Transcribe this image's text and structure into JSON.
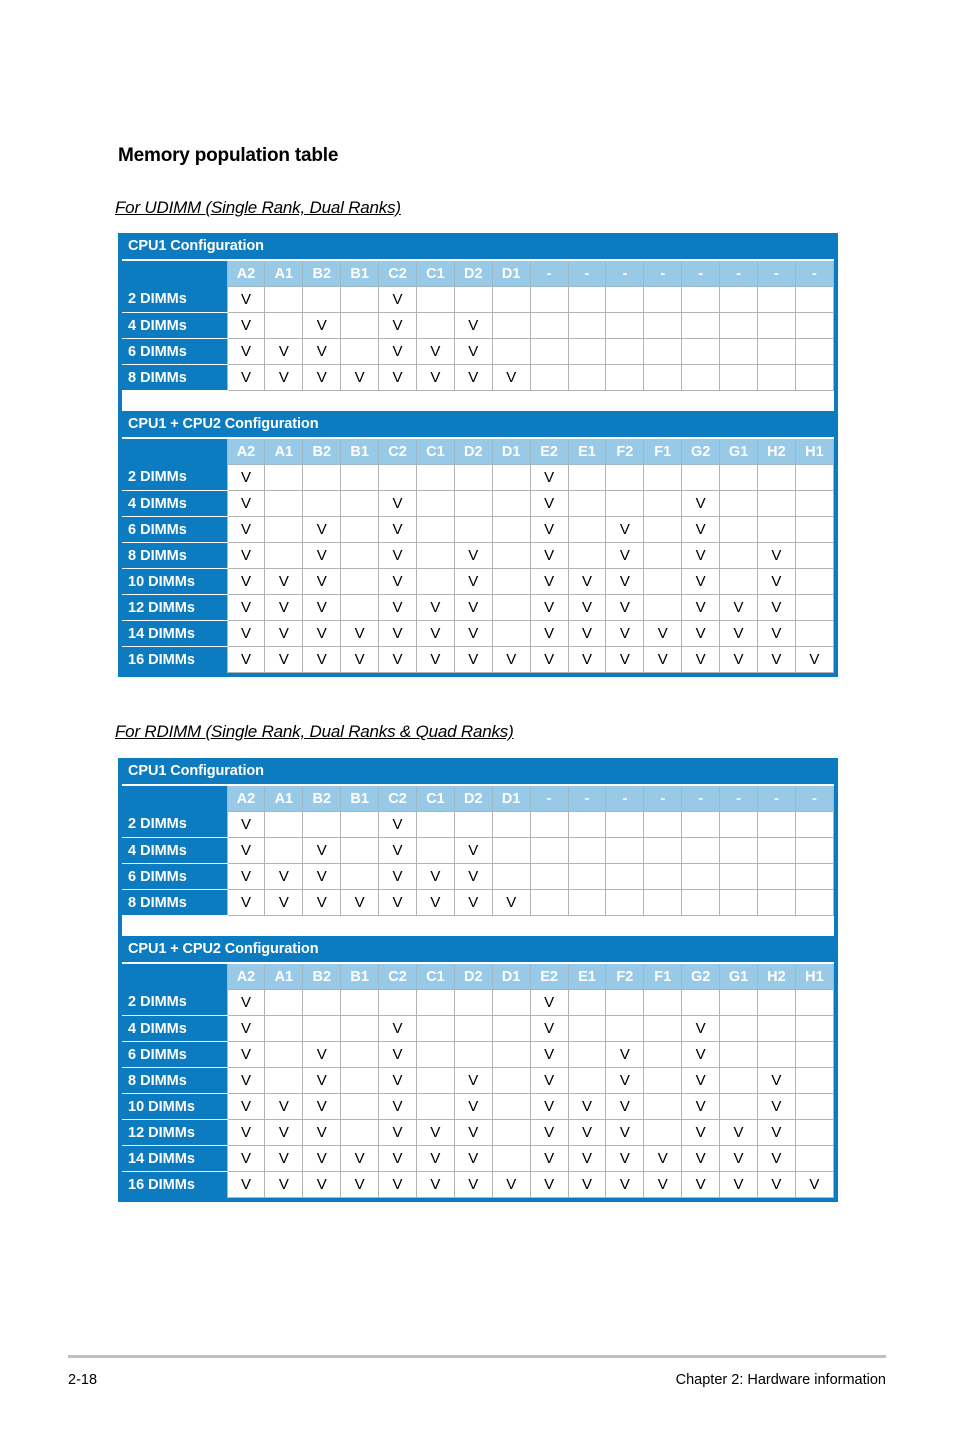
{
  "document": {
    "title": "Memory population table",
    "sections": [
      {
        "id": "udimm",
        "heading": "For UDIMM (Single Rank, Dual Ranks)",
        "tables": [
          {
            "title": "CPU1 Configuration",
            "columns": [
              "A2",
              "A1",
              "B2",
              "B1",
              "C2",
              "C1",
              "D2",
              "D1",
              "-",
              "-",
              "-",
              "-",
              "-",
              "-",
              "-",
              "-"
            ],
            "rows": [
              {
                "label": "2 DIMMs",
                "cells": [
                  "V",
                  "",
                  "",
                  "",
                  "V",
                  "",
                  "",
                  "",
                  "",
                  "",
                  "",
                  "",
                  "",
                  "",
                  "",
                  ""
                ]
              },
              {
                "label": "4 DIMMs",
                "cells": [
                  "V",
                  "",
                  "V",
                  "",
                  "V",
                  "",
                  "V",
                  "",
                  "",
                  "",
                  "",
                  "",
                  "",
                  "",
                  "",
                  ""
                ]
              },
              {
                "label": "6 DIMMs",
                "cells": [
                  "V",
                  "V",
                  "V",
                  "",
                  "V",
                  "V",
                  "V",
                  "",
                  "",
                  "",
                  "",
                  "",
                  "",
                  "",
                  "",
                  ""
                ]
              },
              {
                "label": "8 DIMMs",
                "cells": [
                  "V",
                  "V",
                  "V",
                  "V",
                  "V",
                  "V",
                  "V",
                  "V",
                  "",
                  "",
                  "",
                  "",
                  "",
                  "",
                  "",
                  ""
                ]
              }
            ]
          },
          {
            "title": "CPU1 + CPU2 Configuration",
            "columns": [
              "A2",
              "A1",
              "B2",
              "B1",
              "C2",
              "C1",
              "D2",
              "D1",
              "E2",
              "E1",
              "F2",
              "F1",
              "G2",
              "G1",
              "H2",
              "H1"
            ],
            "rows": [
              {
                "label": "2 DIMMs",
                "cells": [
                  "V",
                  "",
                  "",
                  "",
                  "",
                  "",
                  "",
                  "",
                  "V",
                  "",
                  "",
                  "",
                  "",
                  "",
                  "",
                  ""
                ]
              },
              {
                "label": "4 DIMMs",
                "cells": [
                  "V",
                  "",
                  "",
                  "",
                  "V",
                  "",
                  "",
                  "",
                  "V",
                  "",
                  "",
                  "",
                  "V",
                  "",
                  "",
                  ""
                ]
              },
              {
                "label": "6 DIMMs",
                "cells": [
                  "V",
                  "",
                  "V",
                  "",
                  "V",
                  "",
                  "",
                  "",
                  "V",
                  "",
                  "V",
                  "",
                  "V",
                  "",
                  "",
                  ""
                ]
              },
              {
                "label": "8 DIMMs",
                "cells": [
                  "V",
                  "",
                  "V",
                  "",
                  "V",
                  "",
                  "V",
                  "",
                  "V",
                  "",
                  "V",
                  "",
                  "V",
                  "",
                  "V",
                  ""
                ]
              },
              {
                "label": "10 DIMMs",
                "cells": [
                  "V",
                  "V",
                  "V",
                  "",
                  "V",
                  "",
                  "V",
                  "",
                  "V",
                  "V",
                  "V",
                  "",
                  "V",
                  "",
                  "V",
                  ""
                ]
              },
              {
                "label": "12 DIMMs",
                "cells": [
                  "V",
                  "V",
                  "V",
                  "",
                  "V",
                  "V",
                  "V",
                  "",
                  "V",
                  "V",
                  "V",
                  "",
                  "V",
                  "V",
                  "V",
                  ""
                ]
              },
              {
                "label": "14 DIMMs",
                "cells": [
                  "V",
                  "V",
                  "V",
                  "V",
                  "V",
                  "V",
                  "V",
                  "",
                  "V",
                  "V",
                  "V",
                  "V",
                  "V",
                  "V",
                  "V",
                  ""
                ]
              },
              {
                "label": "16 DIMMs",
                "cells": [
                  "V",
                  "V",
                  "V",
                  "V",
                  "V",
                  "V",
                  "V",
                  "V",
                  "V",
                  "V",
                  "V",
                  "V",
                  "V",
                  "V",
                  "V",
                  "V"
                ]
              }
            ]
          }
        ]
      },
      {
        "id": "rdimm",
        "heading": "For RDIMM (Single Rank, Dual Ranks & Quad Ranks)",
        "tables": [
          {
            "title": "CPU1 Configuration",
            "columns": [
              "A2",
              "A1",
              "B2",
              "B1",
              "C2",
              "C1",
              "D2",
              "D1",
              "-",
              "-",
              "-",
              "-",
              "-",
              "-",
              "-",
              "-"
            ],
            "rows": [
              {
                "label": "2 DIMMs",
                "cells": [
                  "V",
                  "",
                  "",
                  "",
                  "V",
                  "",
                  "",
                  "",
                  "",
                  "",
                  "",
                  "",
                  "",
                  "",
                  "",
                  ""
                ]
              },
              {
                "label": "4 DIMMs",
                "cells": [
                  "V",
                  "",
                  "V",
                  "",
                  "V",
                  "",
                  "V",
                  "",
                  "",
                  "",
                  "",
                  "",
                  "",
                  "",
                  "",
                  ""
                ]
              },
              {
                "label": "6 DIMMs",
                "cells": [
                  "V",
                  "V",
                  "V",
                  "",
                  "V",
                  "V",
                  "V",
                  "",
                  "",
                  "",
                  "",
                  "",
                  "",
                  "",
                  "",
                  ""
                ]
              },
              {
                "label": "8 DIMMs",
                "cells": [
                  "V",
                  "V",
                  "V",
                  "V",
                  "V",
                  "V",
                  "V",
                  "V",
                  "",
                  "",
                  "",
                  "",
                  "",
                  "",
                  "",
                  ""
                ]
              }
            ]
          },
          {
            "title": "CPU1 + CPU2 Configuration",
            "columns": [
              "A2",
              "A1",
              "B2",
              "B1",
              "C2",
              "C1",
              "D2",
              "D1",
              "E2",
              "E1",
              "F2",
              "F1",
              "G2",
              "G1",
              "H2",
              "H1"
            ],
            "rows": [
              {
                "label": "2 DIMMs",
                "cells": [
                  "V",
                  "",
                  "",
                  "",
                  "",
                  "",
                  "",
                  "",
                  "V",
                  "",
                  "",
                  "",
                  "",
                  "",
                  "",
                  ""
                ]
              },
              {
                "label": "4 DIMMs",
                "cells": [
                  "V",
                  "",
                  "",
                  "",
                  "V",
                  "",
                  "",
                  "",
                  "V",
                  "",
                  "",
                  "",
                  "V",
                  "",
                  "",
                  ""
                ]
              },
              {
                "label": "6 DIMMs",
                "cells": [
                  "V",
                  "",
                  "V",
                  "",
                  "V",
                  "",
                  "",
                  "",
                  "V",
                  "",
                  "V",
                  "",
                  "V",
                  "",
                  "",
                  ""
                ]
              },
              {
                "label": "8 DIMMs",
                "cells": [
                  "V",
                  "",
                  "V",
                  "",
                  "V",
                  "",
                  "V",
                  "",
                  "V",
                  "",
                  "V",
                  "",
                  "V",
                  "",
                  "V",
                  ""
                ]
              },
              {
                "label": "10 DIMMs",
                "cells": [
                  "V",
                  "V",
                  "V",
                  "",
                  "V",
                  "",
                  "V",
                  "",
                  "V",
                  "V",
                  "V",
                  "",
                  "V",
                  "",
                  "V",
                  ""
                ]
              },
              {
                "label": "12 DIMMs",
                "cells": [
                  "V",
                  "V",
                  "V",
                  "",
                  "V",
                  "V",
                  "V",
                  "",
                  "V",
                  "V",
                  "V",
                  "",
                  "V",
                  "V",
                  "V",
                  ""
                ]
              },
              {
                "label": "14 DIMMs",
                "cells": [
                  "V",
                  "V",
                  "V",
                  "V",
                  "V",
                  "V",
                  "V",
                  "",
                  "V",
                  "V",
                  "V",
                  "V",
                  "V",
                  "V",
                  "V",
                  ""
                ]
              },
              {
                "label": "16 DIMMs",
                "cells": [
                  "V",
                  "V",
                  "V",
                  "V",
                  "V",
                  "V",
                  "V",
                  "V",
                  "V",
                  "V",
                  "V",
                  "V",
                  "V",
                  "V",
                  "V",
                  "V"
                ]
              }
            ]
          }
        ]
      }
    ]
  },
  "footer": {
    "page_number": "2-18",
    "chapter": "Chapter 2: Hardware information"
  },
  "colors": {
    "header_blue": "#0d7bc0",
    "column_header_blue": "#98c9e6",
    "cell_border": "#b3b3b3",
    "footer_rule": "#bfbfbf"
  }
}
